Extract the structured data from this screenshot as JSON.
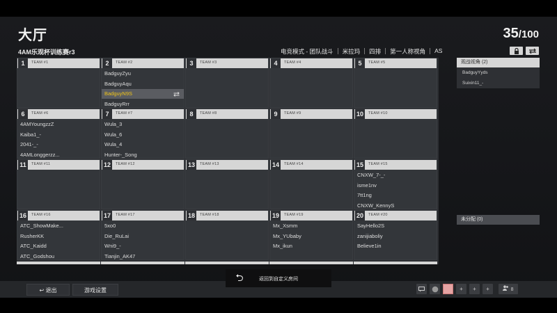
{
  "lobby": {
    "title": "大厅",
    "count_current": "35",
    "count_total": "/100",
    "room_name": "4AM乐观杯训练赛r3",
    "mode_info": [
      "电竞模式 - 团队战斗",
      "米拉玛",
      "四排",
      "第一人称视角",
      "AS"
    ]
  },
  "icons": {
    "lock": "lock-icon",
    "swap": "swap-icon",
    "back": "back-arrow-icon",
    "chat": "chat-icon",
    "globe": "globe-icon",
    "add": "add-slot-icon",
    "friends": "friends-icon"
  },
  "teams": [
    {
      "num": "1",
      "label": "TEAM #1",
      "members": []
    },
    {
      "num": "2",
      "label": "TEAM #2",
      "members": [
        "BadguyZyu",
        "BadguyAqu",
        "BadguyN9S",
        "BadguyRrr"
      ],
      "selected_index": 2
    },
    {
      "num": "3",
      "label": "TEAM #3",
      "members": []
    },
    {
      "num": "4",
      "label": "TEAM #4",
      "members": []
    },
    {
      "num": "5",
      "label": "TEAM #5",
      "members": []
    },
    {
      "num": "6",
      "label": "TEAM #6",
      "members": [
        "4AMYoungzzZ",
        "Kaiba1_-",
        "2041-_-",
        "4AMLonggerzz..."
      ]
    },
    {
      "num": "7",
      "label": "TEAM #7",
      "members": [
        "Wula_3",
        "Wula_6",
        "Wula_4",
        "Hunter-_Song"
      ]
    },
    {
      "num": "8",
      "label": "TEAM #8",
      "members": []
    },
    {
      "num": "9",
      "label": "TEAM #9",
      "members": []
    },
    {
      "num": "10",
      "label": "TEAM #10",
      "members": []
    },
    {
      "num": "11",
      "label": "TEAM #11",
      "members": []
    },
    {
      "num": "12",
      "label": "TEAM #12",
      "members": []
    },
    {
      "num": "13",
      "label": "TEAM #13",
      "members": []
    },
    {
      "num": "14",
      "label": "TEAM #14",
      "members": []
    },
    {
      "num": "15",
      "label": "TEAM #15",
      "members": [
        "CNXW_7-_-",
        "isme1nv",
        "7tt1ng",
        "CNXW_KennyS"
      ]
    },
    {
      "num": "16",
      "label": "TEAM #16",
      "members": [
        "ATC_ShowMake...",
        "RusherKK",
        "ATC_Kaidd",
        "ATC_Godshou"
      ]
    },
    {
      "num": "17",
      "label": "TEAM #17",
      "members": [
        "5xo0",
        "Die_RuLai",
        "Wni9_-",
        "Tianjin_AK47"
      ]
    },
    {
      "num": "18",
      "label": "TEAM #18",
      "members": []
    },
    {
      "num": "19",
      "label": "TEAM #19",
      "members": [
        "Mx_Xsmm",
        "Mx_YUbaby",
        "Mx_ikun"
      ]
    },
    {
      "num": "20",
      "label": "TEAM #20",
      "members": [
        "SayHello2S",
        "zanijiaboliy",
        "Believe1in"
      ]
    }
  ],
  "spectators": {
    "header": "观战视角 (2)",
    "items": [
      "BadguyYyds",
      "Suixin11_-"
    ]
  },
  "unassigned": {
    "header": "未分配 (0)"
  },
  "bottom": {
    "exit_label": "退出",
    "exit_arrow": "↩",
    "settings_label": "游戏设置",
    "back_label": "返回到自定义房间",
    "back_arrow": "⮌",
    "friends_count": "8",
    "add_glyph": "+"
  }
}
